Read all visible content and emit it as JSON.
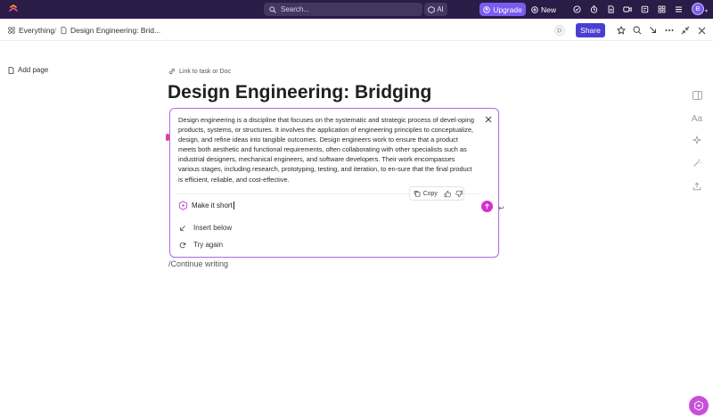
{
  "topbar": {
    "search_placeholder": "Search...",
    "ai_label": "AI",
    "upgrade_label": "Upgrade",
    "new_label": "New",
    "avatar_initial": "B"
  },
  "breadcrumb": {
    "space": "Everything",
    "separator": "/",
    "doc": "Design Engineering: Brid..."
  },
  "toolbar": {
    "share_label": "Share"
  },
  "sidebar": {
    "add_page_label": "Add page"
  },
  "doc": {
    "link_label": "Link to task or Doc",
    "title": "Design Engineering: Bridging",
    "continue_label": "/Continue writing"
  },
  "ai_panel": {
    "response": "Design engineering is a discipline that focuses on the systematic and strategic process of devel-oping products, systems, or structures. It involves the application of engineering principles to conceptualize, design, and refine ideas into tangible outcomes. Design engineers work to ensure that a product meets both aesthetic and functional requirements, often collaborating with other specialists such as industrial designers, mechanical engineers, and software developers. Their work encompasses various stages, including research, prototyping, testing, and iteration, to en-sure that the final product is efficient, reliable, and cost-effective.",
    "copy_label": "Copy",
    "prompt_value": "Make it short",
    "options": [
      {
        "label": "Insert below",
        "icon": "arrow-down-left-icon"
      },
      {
        "label": "Try again",
        "icon": "refresh-icon"
      }
    ]
  },
  "colors": {
    "topbar_bg": "#2b1b47",
    "upgrade": "#7b5cf0",
    "share": "#4a3fd1",
    "ai_accent": "#d62fd0"
  }
}
